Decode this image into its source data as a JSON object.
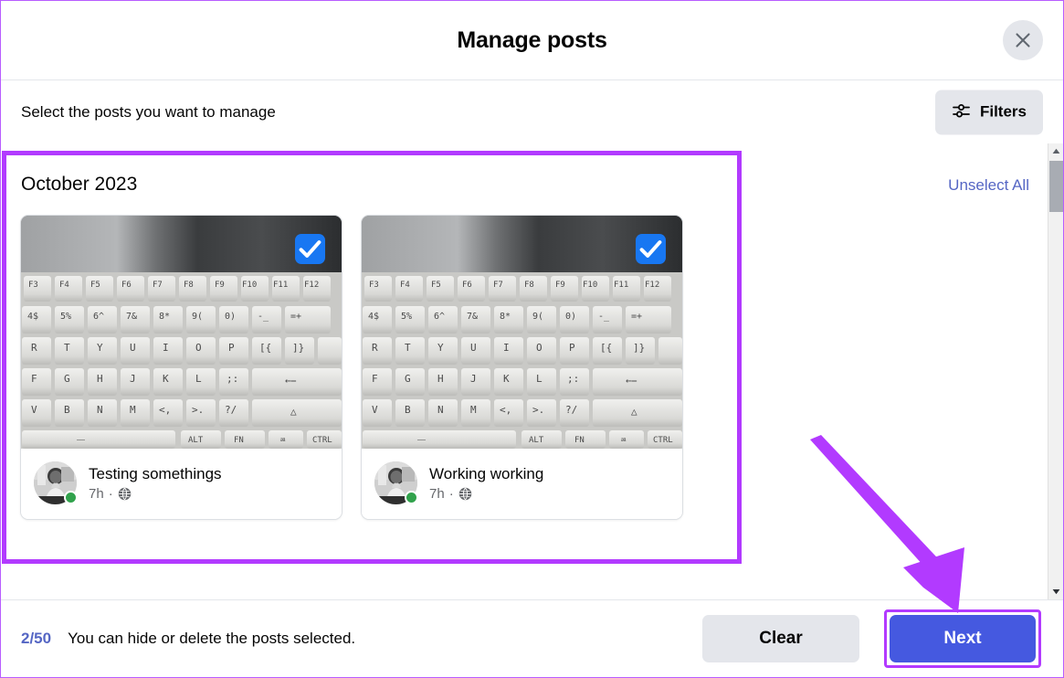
{
  "dialog": {
    "title": "Manage posts",
    "close_label": "Close",
    "close_icon": "close-icon"
  },
  "subheader": {
    "instruction": "Select the posts you want to manage",
    "filters_label": "Filters",
    "filters_icon": "sliders-icon"
  },
  "content": {
    "month_heading": "October 2023",
    "unselect_all_label": "Unselect All",
    "posts": [
      {
        "title": "Testing somethings",
        "time": "7h",
        "separator": "·",
        "audience_icon": "globe-icon",
        "selected": true,
        "thumbnail_alt": "keyboard-photo",
        "avatar_alt": "profile-photo",
        "online": true
      },
      {
        "title": "Working working",
        "time": "7h",
        "separator": "·",
        "audience_icon": "globe-icon",
        "selected": true,
        "thumbnail_alt": "keyboard-photo",
        "avatar_alt": "profile-photo",
        "online": true
      }
    ]
  },
  "footer": {
    "count": "2/50",
    "note": "You can hide or delete the posts selected.",
    "clear_label": "Clear",
    "next_label": "Next"
  },
  "colors": {
    "accent_blue": "#1877f2",
    "next_blue": "#4559e0",
    "link_blue": "#5566c4",
    "highlight_purple": "#b23aff",
    "online_green": "#31a24c",
    "button_gray": "#e4e6eb"
  }
}
